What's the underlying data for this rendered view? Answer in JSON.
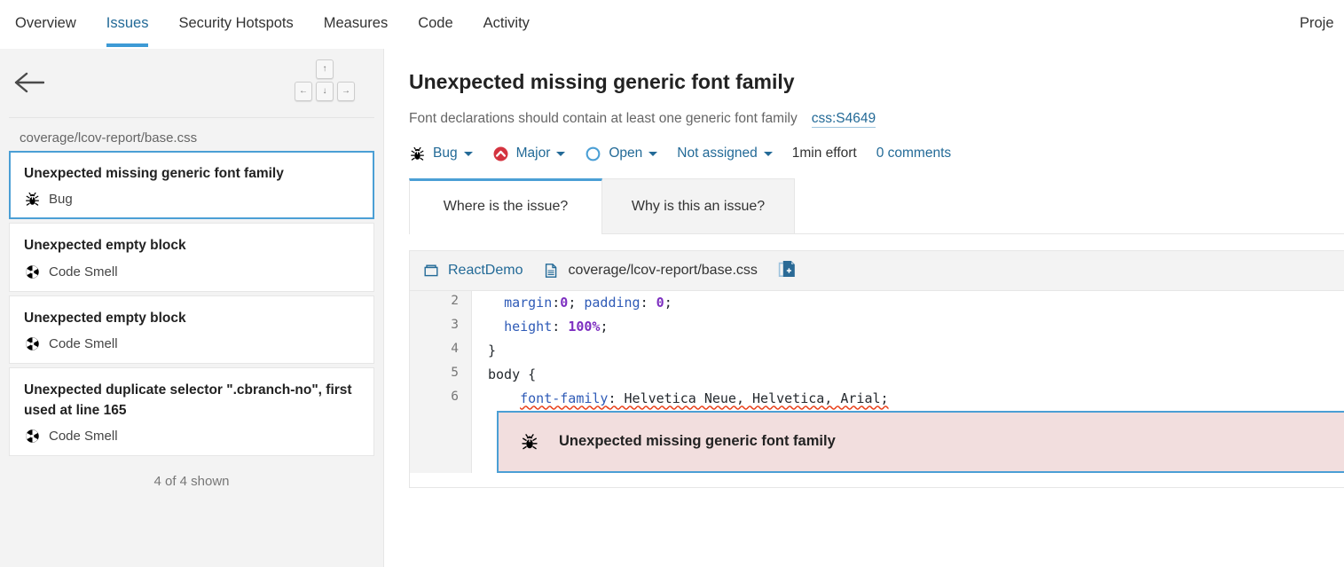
{
  "topnav": {
    "items": [
      {
        "label": "Overview",
        "active": false
      },
      {
        "label": "Issues",
        "active": true
      },
      {
        "label": "Security Hotspots",
        "active": false
      },
      {
        "label": "Measures",
        "active": false
      },
      {
        "label": "Code",
        "active": false
      },
      {
        "label": "Activity",
        "active": false
      }
    ],
    "right_label": "Proje"
  },
  "sidebar": {
    "back_icon": "arrow-left-icon",
    "keyboard_hints": {
      "up": "↑",
      "left": "←",
      "down": "↓",
      "right": "→"
    },
    "file_path": "coverage/lcov-report/base.css",
    "issues": [
      {
        "title": "Unexpected missing generic font family",
        "type": "Bug",
        "type_icon": "bug-icon",
        "selected": true
      },
      {
        "title": "Unexpected empty block",
        "type": "Code Smell",
        "type_icon": "code-smell-icon",
        "selected": false
      },
      {
        "title": "Unexpected empty block",
        "type": "Code Smell",
        "type_icon": "code-smell-icon",
        "selected": false
      },
      {
        "title": "Unexpected duplicate selector \".cbranch-no\", first used at line 165",
        "type": "Code Smell",
        "type_icon": "code-smell-icon",
        "selected": false
      }
    ],
    "shown_count": "4 of 4 shown"
  },
  "main": {
    "headline": "Unexpected missing generic font family",
    "description": "Font declarations should contain at least one generic font family",
    "rule_key": "css:S4649",
    "meta": {
      "type": "Bug",
      "type_icon": "bug-icon",
      "severity": "Major",
      "severity_icon": "severity-major-icon",
      "status": "Open",
      "status_icon": "status-open-icon",
      "assignee": "Not assigned",
      "effort": "1min effort",
      "comments": "0 comments"
    },
    "tabs": [
      {
        "label": "Where is the issue?",
        "active": true
      },
      {
        "label": "Why is this an issue?",
        "active": false
      }
    ],
    "breadcrumb": {
      "project_icon": "project-box-icon",
      "project": "ReactDemo",
      "file_icon": "file-icon",
      "file": "coverage/lcov-report/base.css",
      "action_icon": "open-in-new-file-icon"
    },
    "code": {
      "lines": [
        {
          "number": "2",
          "tokens": [
            {
              "text": "  ",
              "kind": "plain"
            },
            {
              "text": "margin",
              "kind": "prop"
            },
            {
              "text": ":",
              "kind": "plain"
            },
            {
              "text": "0",
              "kind": "num"
            },
            {
              "text": "; ",
              "kind": "plain"
            },
            {
              "text": "padding",
              "kind": "prop"
            },
            {
              "text": ": ",
              "kind": "plain"
            },
            {
              "text": "0",
              "kind": "num"
            },
            {
              "text": ";",
              "kind": "plain"
            }
          ]
        },
        {
          "number": "3",
          "tokens": [
            {
              "text": "  ",
              "kind": "plain"
            },
            {
              "text": "height",
              "kind": "prop"
            },
            {
              "text": ": ",
              "kind": "plain"
            },
            {
              "text": "100%",
              "kind": "num"
            },
            {
              "text": ";",
              "kind": "plain"
            }
          ]
        },
        {
          "number": "4",
          "tokens": [
            {
              "text": "}",
              "kind": "plain"
            }
          ]
        },
        {
          "number": "5",
          "tokens": [
            {
              "text": "body {",
              "kind": "plain"
            }
          ]
        },
        {
          "number": "6",
          "underline": true,
          "tokens": [
            {
              "text": "    ",
              "kind": "plain"
            },
            {
              "text": "font-family",
              "kind": "prop"
            },
            {
              "text": ": Helvetica Neue, Helvetica, Arial;",
              "kind": "plain"
            }
          ]
        }
      ],
      "inline_issue": {
        "icon": "bug-icon",
        "message": "Unexpected missing generic font family"
      }
    }
  },
  "colors": {
    "accent_blue": "#4b9fd5",
    "link_blue": "#236a97",
    "severity_red": "#d4333f",
    "issue_bg_pink": "#f2dede",
    "sidebar_bg": "#f3f3f3"
  }
}
